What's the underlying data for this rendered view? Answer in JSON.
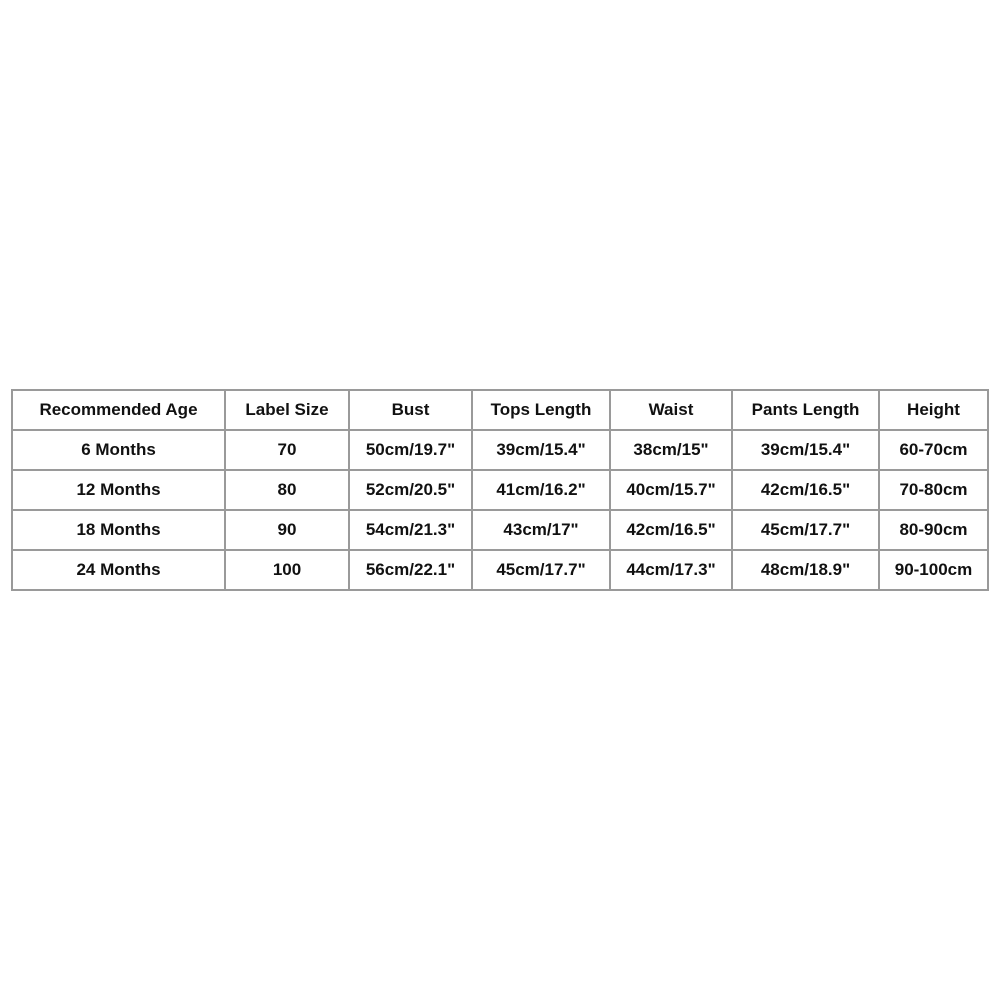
{
  "size_chart": {
    "headers": [
      "Recommended Age",
      "Label Size",
      "Bust",
      "Tops Length",
      "Waist",
      "Pants Length",
      "Height"
    ],
    "rows": [
      [
        "6 Months",
        "70",
        "50cm/19.7\"",
        "39cm/15.4\"",
        "38cm/15\"",
        "39cm/15.4\"",
        "60-70cm"
      ],
      [
        "12 Months",
        "80",
        "52cm/20.5\"",
        "41cm/16.2\"",
        "40cm/15.7\"",
        "42cm/16.5\"",
        "70-80cm"
      ],
      [
        "18 Months",
        "90",
        "54cm/21.3\"",
        "43cm/17\"",
        "42cm/16.5\"",
        "45cm/17.7\"",
        "80-90cm"
      ],
      [
        "24 Months",
        "100",
        "56cm/22.1\"",
        "45cm/17.7\"",
        "44cm/17.3\"",
        "48cm/18.9\"",
        "90-100cm"
      ]
    ]
  }
}
